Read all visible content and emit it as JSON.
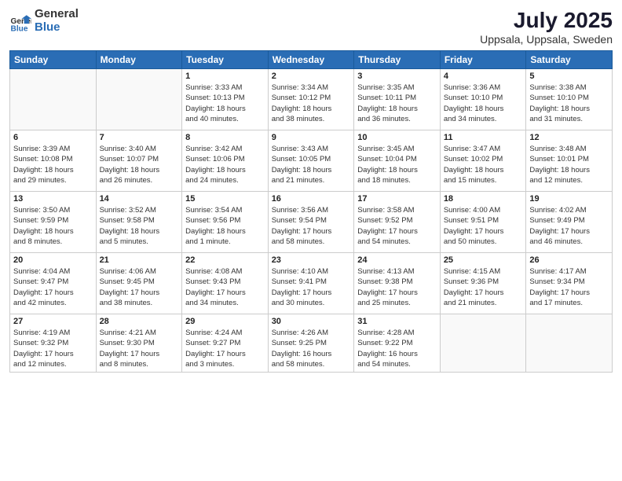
{
  "logo": {
    "general": "General",
    "blue": "Blue"
  },
  "title": "July 2025",
  "location": "Uppsala, Uppsala, Sweden",
  "days_header": [
    "Sunday",
    "Monday",
    "Tuesday",
    "Wednesday",
    "Thursday",
    "Friday",
    "Saturday"
  ],
  "weeks": [
    [
      {
        "day": "",
        "info": ""
      },
      {
        "day": "",
        "info": ""
      },
      {
        "day": "1",
        "info": "Sunrise: 3:33 AM\nSunset: 10:13 PM\nDaylight: 18 hours\nand 40 minutes."
      },
      {
        "day": "2",
        "info": "Sunrise: 3:34 AM\nSunset: 10:12 PM\nDaylight: 18 hours\nand 38 minutes."
      },
      {
        "day": "3",
        "info": "Sunrise: 3:35 AM\nSunset: 10:11 PM\nDaylight: 18 hours\nand 36 minutes."
      },
      {
        "day": "4",
        "info": "Sunrise: 3:36 AM\nSunset: 10:10 PM\nDaylight: 18 hours\nand 34 minutes."
      },
      {
        "day": "5",
        "info": "Sunrise: 3:38 AM\nSunset: 10:10 PM\nDaylight: 18 hours\nand 31 minutes."
      }
    ],
    [
      {
        "day": "6",
        "info": "Sunrise: 3:39 AM\nSunset: 10:08 PM\nDaylight: 18 hours\nand 29 minutes."
      },
      {
        "day": "7",
        "info": "Sunrise: 3:40 AM\nSunset: 10:07 PM\nDaylight: 18 hours\nand 26 minutes."
      },
      {
        "day": "8",
        "info": "Sunrise: 3:42 AM\nSunset: 10:06 PM\nDaylight: 18 hours\nand 24 minutes."
      },
      {
        "day": "9",
        "info": "Sunrise: 3:43 AM\nSunset: 10:05 PM\nDaylight: 18 hours\nand 21 minutes."
      },
      {
        "day": "10",
        "info": "Sunrise: 3:45 AM\nSunset: 10:04 PM\nDaylight: 18 hours\nand 18 minutes."
      },
      {
        "day": "11",
        "info": "Sunrise: 3:47 AM\nSunset: 10:02 PM\nDaylight: 18 hours\nand 15 minutes."
      },
      {
        "day": "12",
        "info": "Sunrise: 3:48 AM\nSunset: 10:01 PM\nDaylight: 18 hours\nand 12 minutes."
      }
    ],
    [
      {
        "day": "13",
        "info": "Sunrise: 3:50 AM\nSunset: 9:59 PM\nDaylight: 18 hours\nand 8 minutes."
      },
      {
        "day": "14",
        "info": "Sunrise: 3:52 AM\nSunset: 9:58 PM\nDaylight: 18 hours\nand 5 minutes."
      },
      {
        "day": "15",
        "info": "Sunrise: 3:54 AM\nSunset: 9:56 PM\nDaylight: 18 hours\nand 1 minute."
      },
      {
        "day": "16",
        "info": "Sunrise: 3:56 AM\nSunset: 9:54 PM\nDaylight: 17 hours\nand 58 minutes."
      },
      {
        "day": "17",
        "info": "Sunrise: 3:58 AM\nSunset: 9:52 PM\nDaylight: 17 hours\nand 54 minutes."
      },
      {
        "day": "18",
        "info": "Sunrise: 4:00 AM\nSunset: 9:51 PM\nDaylight: 17 hours\nand 50 minutes."
      },
      {
        "day": "19",
        "info": "Sunrise: 4:02 AM\nSunset: 9:49 PM\nDaylight: 17 hours\nand 46 minutes."
      }
    ],
    [
      {
        "day": "20",
        "info": "Sunrise: 4:04 AM\nSunset: 9:47 PM\nDaylight: 17 hours\nand 42 minutes."
      },
      {
        "day": "21",
        "info": "Sunrise: 4:06 AM\nSunset: 9:45 PM\nDaylight: 17 hours\nand 38 minutes."
      },
      {
        "day": "22",
        "info": "Sunrise: 4:08 AM\nSunset: 9:43 PM\nDaylight: 17 hours\nand 34 minutes."
      },
      {
        "day": "23",
        "info": "Sunrise: 4:10 AM\nSunset: 9:41 PM\nDaylight: 17 hours\nand 30 minutes."
      },
      {
        "day": "24",
        "info": "Sunrise: 4:13 AM\nSunset: 9:38 PM\nDaylight: 17 hours\nand 25 minutes."
      },
      {
        "day": "25",
        "info": "Sunrise: 4:15 AM\nSunset: 9:36 PM\nDaylight: 17 hours\nand 21 minutes."
      },
      {
        "day": "26",
        "info": "Sunrise: 4:17 AM\nSunset: 9:34 PM\nDaylight: 17 hours\nand 17 minutes."
      }
    ],
    [
      {
        "day": "27",
        "info": "Sunrise: 4:19 AM\nSunset: 9:32 PM\nDaylight: 17 hours\nand 12 minutes."
      },
      {
        "day": "28",
        "info": "Sunrise: 4:21 AM\nSunset: 9:30 PM\nDaylight: 17 hours\nand 8 minutes."
      },
      {
        "day": "29",
        "info": "Sunrise: 4:24 AM\nSunset: 9:27 PM\nDaylight: 17 hours\nand 3 minutes."
      },
      {
        "day": "30",
        "info": "Sunrise: 4:26 AM\nSunset: 9:25 PM\nDaylight: 16 hours\nand 58 minutes."
      },
      {
        "day": "31",
        "info": "Sunrise: 4:28 AM\nSunset: 9:22 PM\nDaylight: 16 hours\nand 54 minutes."
      },
      {
        "day": "",
        "info": ""
      },
      {
        "day": "",
        "info": ""
      }
    ]
  ]
}
